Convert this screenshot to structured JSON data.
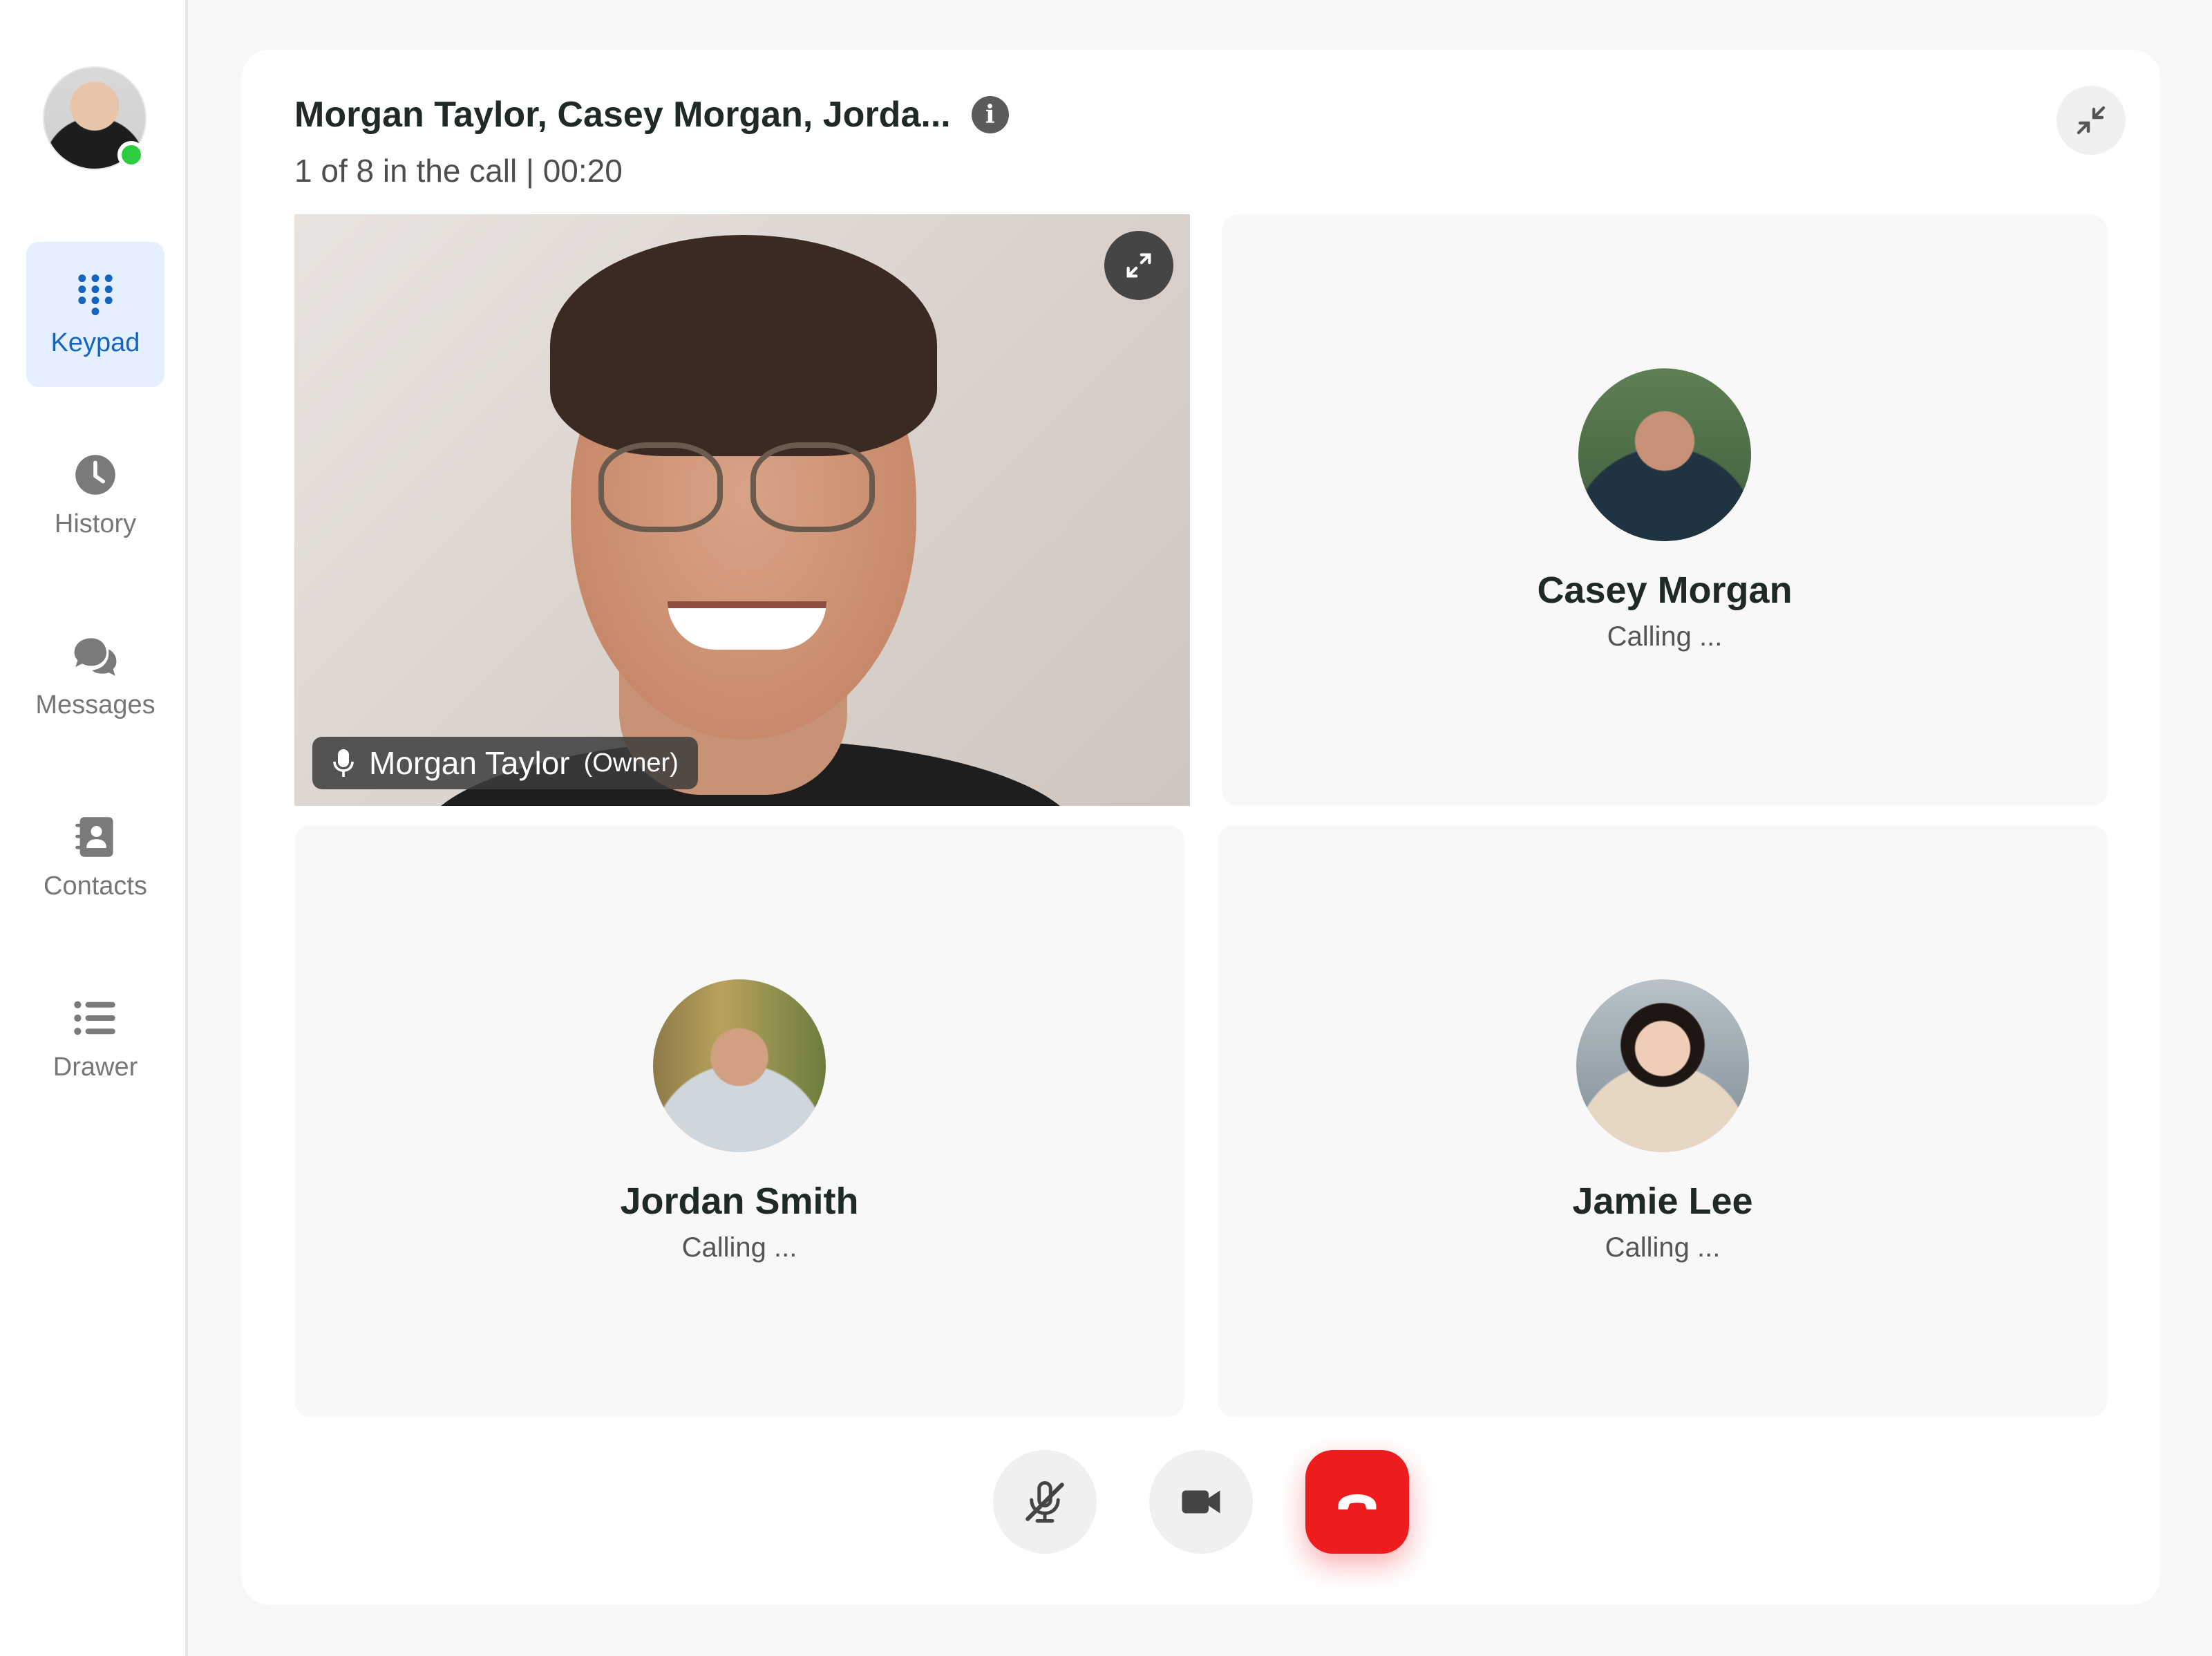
{
  "sidebar": {
    "items": [
      {
        "label": "Keypad",
        "icon": "keypad-icon",
        "active": true
      },
      {
        "label": "History",
        "icon": "clock-icon"
      },
      {
        "label": "Messages",
        "icon": "chat-bubbles-icon"
      },
      {
        "label": "Contacts",
        "icon": "contacts-book-icon"
      },
      {
        "label": "Drawer",
        "icon": "list-icon"
      }
    ],
    "presence_color": "#2ecc40"
  },
  "call": {
    "title": "Morgan Taylor, Casey Morgan, Jorda...",
    "subtitle": "1 of 8 in the call | 00:20"
  },
  "participants": {
    "owner": {
      "name": "Morgan Taylor",
      "role": "(Owner)"
    },
    "casey": {
      "name": "Casey Morgan",
      "status": "Calling ..."
    },
    "jordan": {
      "name": "Jordan Smith",
      "status": "Calling ..."
    },
    "jamie": {
      "name": "Jamie Lee",
      "status": "Calling ..."
    }
  },
  "controls": {
    "mute": "mic-off-icon",
    "video": "video-camera-icon",
    "end": "hang-up-icon",
    "end_color": "#ee1c1c"
  },
  "colors": {
    "accent": "#1565c0",
    "active_nav_bg": "#e4efff"
  }
}
